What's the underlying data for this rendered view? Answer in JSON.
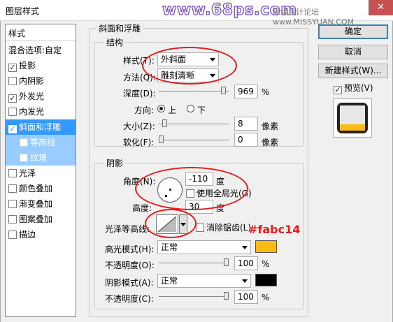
{
  "window": {
    "title": "图层样式",
    "close": "✕"
  },
  "watermark": {
    "main": "www.68ps.com",
    "sub": "思缘设计论坛 www.MISSYUAN.COM"
  },
  "sidebar": {
    "header": "样式",
    "items": [
      {
        "label": "混合选项:自定",
        "checkbox": false,
        "checked": false
      },
      {
        "label": "投影",
        "checkbox": true,
        "checked": true
      },
      {
        "label": "内阴影",
        "checkbox": true,
        "checked": false
      },
      {
        "label": "外发光",
        "checkbox": true,
        "checked": true
      },
      {
        "label": "内发光",
        "checkbox": true,
        "checked": false
      },
      {
        "label": "斜面和浮雕",
        "checkbox": true,
        "checked": true,
        "selected": true
      },
      {
        "label": "等高线",
        "checkbox": true,
        "checked": false,
        "sub": true
      },
      {
        "label": "纹理",
        "checkbox": true,
        "checked": false,
        "sub": true
      },
      {
        "label": "光泽",
        "checkbox": true,
        "checked": false
      },
      {
        "label": "颜色叠加",
        "checkbox": true,
        "checked": false
      },
      {
        "label": "渐变叠加",
        "checkbox": true,
        "checked": false
      },
      {
        "label": "图案叠加",
        "checkbox": true,
        "checked": false
      },
      {
        "label": "描边",
        "checkbox": true,
        "checked": false
      }
    ]
  },
  "bevel": {
    "title": "斜面和浮雕",
    "structure": {
      "title": "结构",
      "style_label": "样式(T):",
      "style_value": "外斜面",
      "technique_label": "方法(Q):",
      "technique_value": "雕刻清晰",
      "depth_label": "深度(D):",
      "depth_value": "969",
      "depth_unit": "%",
      "depth_level": 0.97,
      "direction_label": "方向:",
      "dir_up": "上",
      "dir_down": "下",
      "size_label": "大小(Z):",
      "size_value": "8",
      "size_unit": "像素",
      "size_level": 0.05,
      "soften_label": "软化(F):",
      "soften_value": "0",
      "soften_unit": "像素",
      "soften_level": 0
    },
    "shading": {
      "title": "阴影",
      "angle_label": "角度(N):",
      "angle_value": "-110",
      "angle_unit": "度",
      "global_light_label": "使用全局光(G)",
      "altitude_label": "高度:",
      "altitude_value": "30",
      "altitude_unit": "度",
      "gloss_contour_label": "光泽等高线:",
      "antialias_label": "消除锯齿(L)",
      "annotation": "#fabc14",
      "highlight_mode_label": "高光模式(H):",
      "highlight_mode_value": "正常",
      "highlight_color": "#fabc14",
      "highlight_opacity_label": "不透明度(O):",
      "highlight_opacity_value": "100",
      "highlight_opacity_unit": "%",
      "shadow_mode_label": "阴影模式(A):",
      "shadow_mode_value": "正常",
      "shadow_color": "#000000",
      "shadow_opacity_label": "不透明度(C):",
      "shadow_opacity_value": "100",
      "shadow_opacity_unit": "%"
    }
  },
  "buttons": {
    "ok": "确定",
    "cancel": "取消",
    "new_style": "新建样式(W)...",
    "preview": "预览(V)"
  },
  "colors": {
    "annotation_red": "#e02020",
    "selection": "#3399ff"
  }
}
